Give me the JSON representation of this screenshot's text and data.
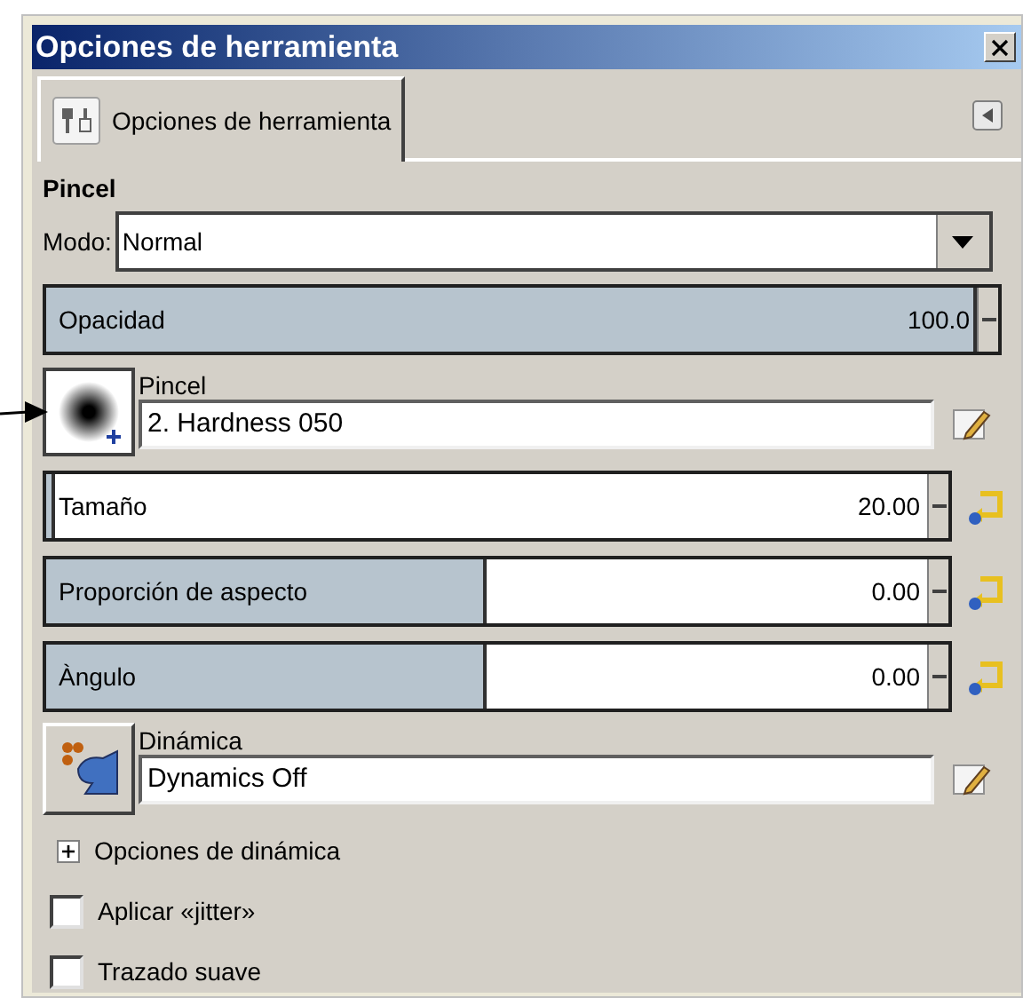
{
  "window": {
    "title": "Opciones de herramienta"
  },
  "tabs": [
    {
      "label": "Opciones de herramienta",
      "selected": true
    }
  ],
  "section": "Pincel",
  "mode": {
    "label": "Modo:",
    "value": "Normal"
  },
  "opacity": {
    "label": "Opacidad",
    "value": "100.0",
    "level": 1
  },
  "brush": {
    "label": "Pincel",
    "value": "2. Hardness 050"
  },
  "sliders": [
    {
      "label": "Tamaño",
      "value": "20.00",
      "level": 0.01
    },
    {
      "label": "Proporción de aspecto",
      "value": "0.00",
      "level": 0.5
    },
    {
      "label": "Àngulo",
      "value": "0.00",
      "level": 0.5
    }
  ],
  "dynamics": {
    "label": "Dinámica",
    "value": "Dynamics Off"
  },
  "dynamics_options": {
    "label": "Opciones de dinámica",
    "expanded": false
  },
  "checkboxes": [
    {
      "label": "Aplicar «jitter»",
      "checked": false
    },
    {
      "label": "Trazado suave",
      "checked": false
    }
  ]
}
